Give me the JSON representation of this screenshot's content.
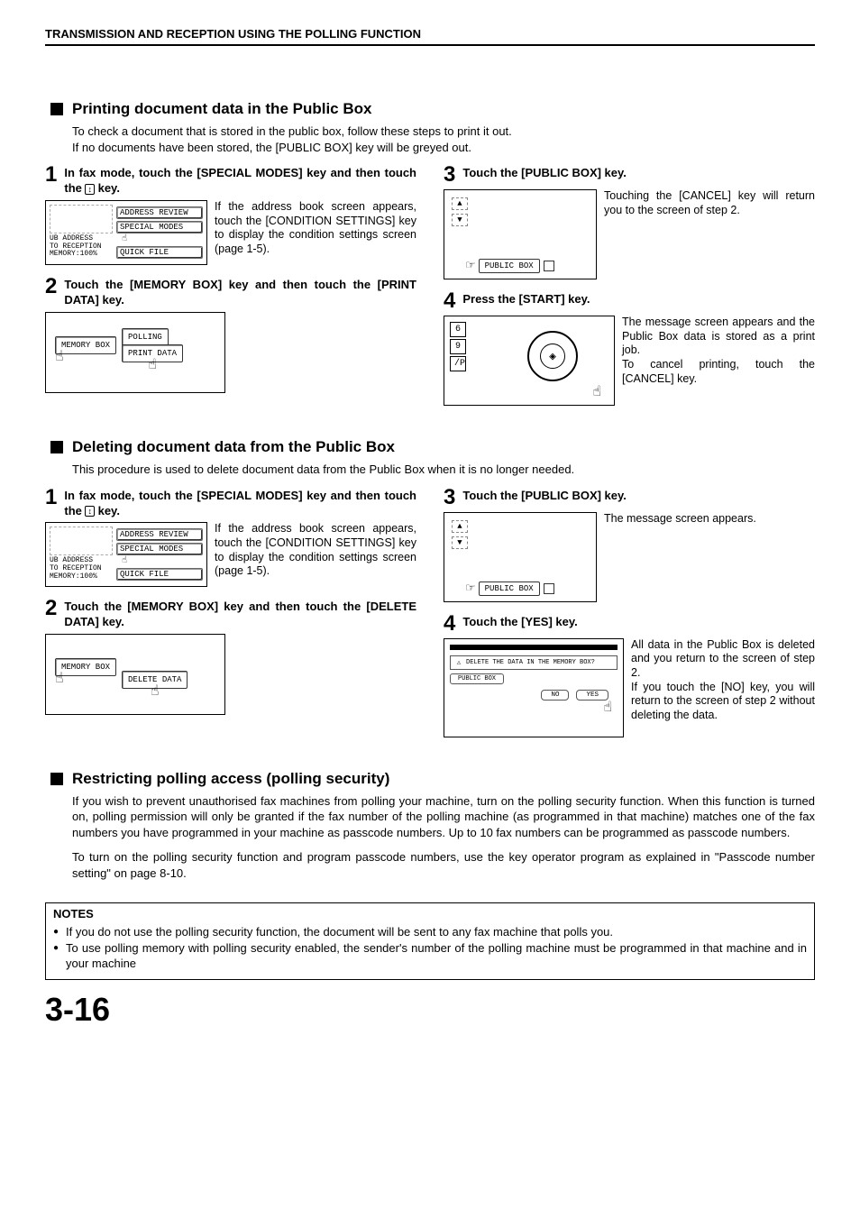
{
  "header": {
    "title": "TRANSMISSION AND RECEPTION USING THE POLLING FUNCTION"
  },
  "section_a": {
    "heading": "Printing document data in the Public Box",
    "intro_l1": "To check a document that is stored in the public box, follow these steps to print it out.",
    "intro_l2": "If no documents have been stored, the [PUBLIC BOX] key will be greyed out.",
    "s1": {
      "num": "1",
      "title_a": "In fax mode, touch the [SPECIAL MODES] key and then touch the ",
      "title_b": " key.",
      "scroll": "↕",
      "panel": {
        "addr_review": "ADDRESS REVIEW",
        "special_modes": "SPECIAL MODES",
        "quick_file": "QUICK FILE",
        "ub_address": "UB ADDRESS",
        "to_reception": "TO RECEPTION",
        "memory": "MEMORY:100%"
      },
      "desc": "If the address book screen appears, touch the [CONDITION SETTINGS] key to display the condition settings screen (page 1-5)."
    },
    "s2": {
      "num": "2",
      "title": "Touch the [MEMORY BOX] key and then touch the [PRINT DATA] key.",
      "panel": {
        "memory_box": "MEMORY BOX",
        "polling": "POLLING",
        "print_data": "PRINT DATA"
      }
    },
    "s3": {
      "num": "3",
      "title": "Touch the [PUBLIC BOX] key.",
      "panel": {
        "public_box": "PUBLIC BOX"
      },
      "desc": "Touching the [CANCEL] key will return you to the screen of step 2."
    },
    "s4": {
      "num": "4",
      "title": "Press the [START] key.",
      "panel": {
        "k1": "6",
        "k2": "9",
        "k3": "/P"
      },
      "desc_a": "The message screen appears and the Public Box data is stored as a print job.",
      "desc_b": "To cancel printing, touch the [CANCEL] key."
    }
  },
  "section_b": {
    "heading": "Deleting document data from the Public Box",
    "intro": "This procedure is used to delete document data from the Public Box when it is no longer needed.",
    "s1": {
      "num": "1",
      "title_a": "In fax mode, touch the [SPECIAL MODES] key and then touch the ",
      "title_b": " key.",
      "scroll": "↕",
      "panel": {
        "addr_review": "ADDRESS REVIEW",
        "special_modes": "SPECIAL MODES",
        "quick_file": "QUICK FILE",
        "ub_address": "UB ADDRESS",
        "to_reception": "TO RECEPTION",
        "memory": "MEMORY:100%"
      },
      "desc": "If the address book screen appears, touch the [CONDITION SETTINGS] key to display the condition settings screen (page 1-5)."
    },
    "s2": {
      "num": "2",
      "title": "Touch the [MEMORY BOX] key and then touch the [DELETE DATA] key.",
      "panel": {
        "memory_box": "MEMORY BOX",
        "delete_data": "DELETE DATA"
      }
    },
    "s3": {
      "num": "3",
      "title": "Touch the [PUBLIC BOX] key.",
      "panel": {
        "public_box": "PUBLIC BOX"
      },
      "desc": "The message screen appears."
    },
    "s4": {
      "num": "4",
      "title": "Touch the [YES] key.",
      "panel": {
        "msg": "DELETE THE DATA IN THE MEMORY BOX?",
        "public_box": "PUBLIC BOX",
        "no": "NO",
        "yes": "YES"
      },
      "desc_a": "All data in the Public Box is deleted and you return to the screen of step 2.",
      "desc_b": "If you touch the [NO] key, you will return to the screen of step 2 without deleting the data."
    }
  },
  "section_c": {
    "heading": "Restricting polling access (polling security)",
    "p1": "If you wish to prevent unauthorised fax machines from polling your machine, turn on the polling security function. When this function is turned on, polling permission will only be granted if the fax number of the polling machine (as programmed in that machine) matches one of the fax numbers you have programmed in your machine as passcode numbers. Up to 10 fax numbers can be programmed as passcode numbers.",
    "p2": "To turn on the polling security function and program passcode numbers, use the key operator program as explained in \"Passcode number setting\" on page 8-10."
  },
  "notes": {
    "title": "NOTES",
    "n1": "If you do not use the polling security function, the document will be sent to any fax machine that polls you.",
    "n2": "To use polling memory with polling security enabled, the sender's number of the polling machine must be programmed in that machine and in your machine"
  },
  "page_number": "3-16"
}
